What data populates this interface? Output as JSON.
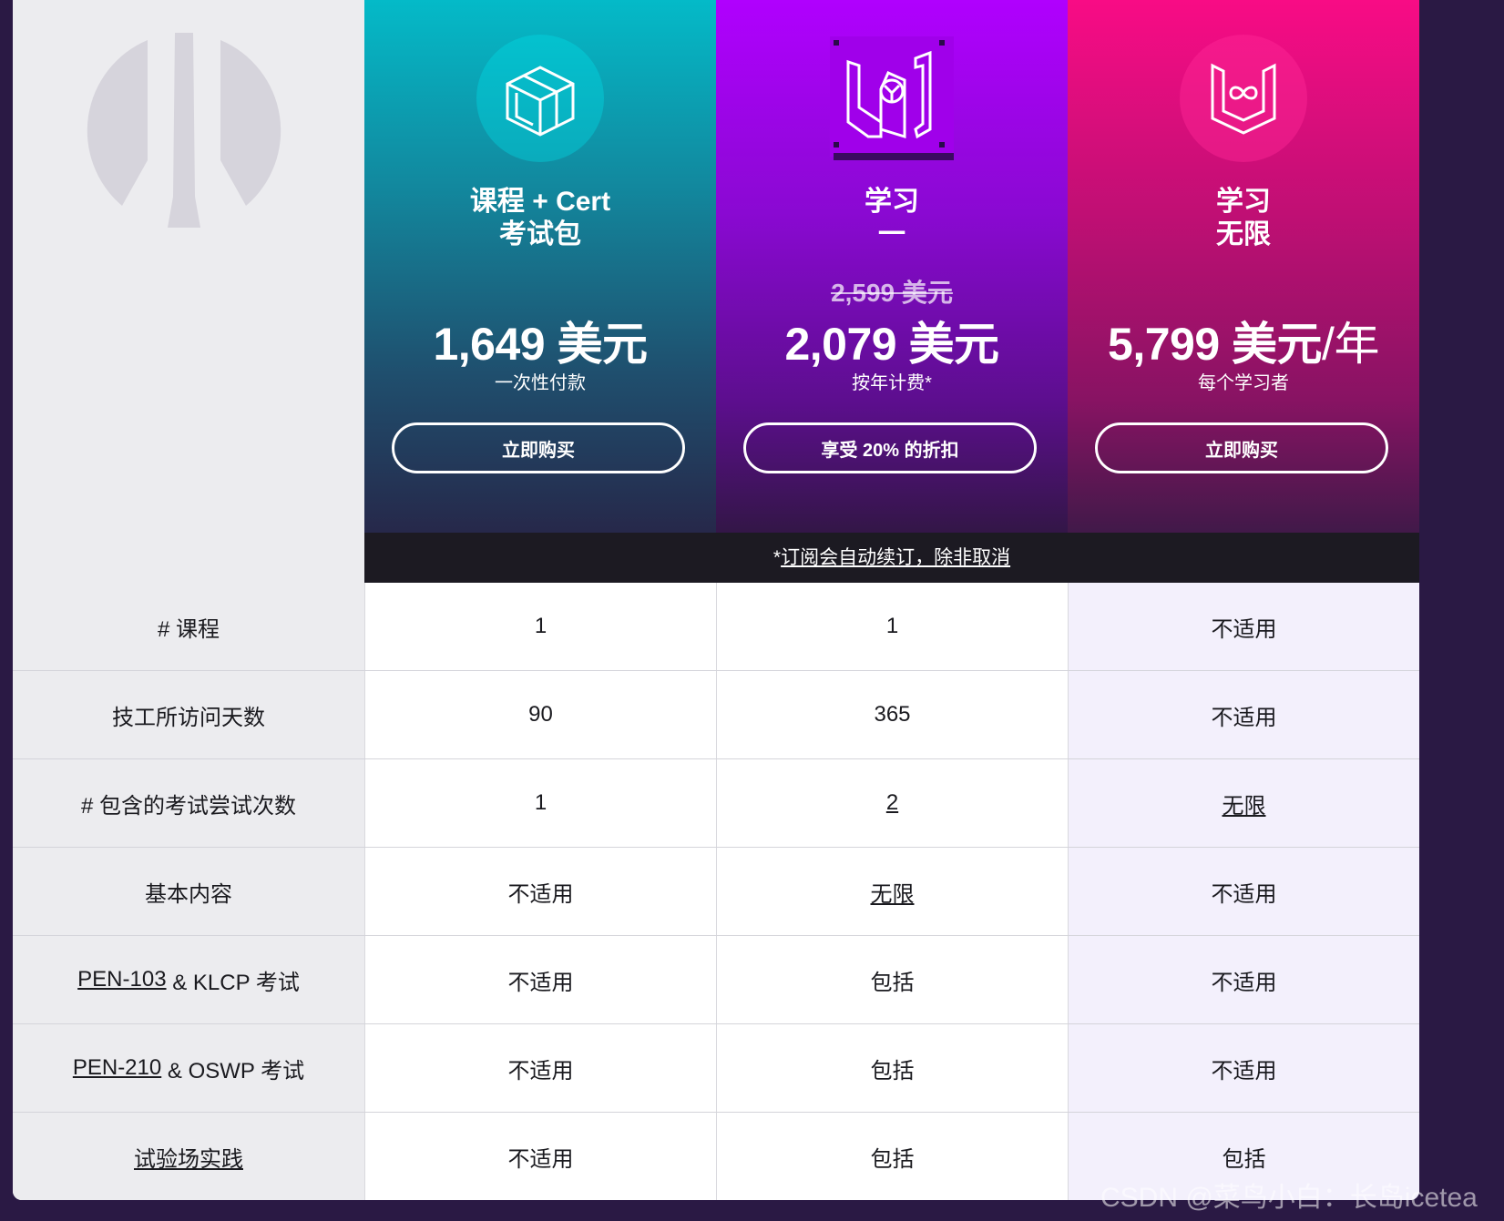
{
  "plans": [
    {
      "title_line1": "课程 + Cert",
      "title_line2": "考试包",
      "old_price": "",
      "price": "1,649 美元",
      "price_unit": "",
      "note": "一次性付款",
      "cta": "立即购买"
    },
    {
      "title_line1": "学习",
      "title_line2": "一",
      "old_price": "2,599 美元",
      "price": "2,079 美元",
      "price_unit": "",
      "note": "按年计费*",
      "cta": "享受 20% 的折扣"
    },
    {
      "title_line1": "学习",
      "title_line2": "无限",
      "old_price": "",
      "price": "5,799 美元",
      "price_unit": "/年",
      "note": "每个学习者",
      "cta": "立即购买"
    }
  ],
  "renew_note": {
    "prefix": "*",
    "link": "订阅会自动续订，除非取消"
  },
  "rows": [
    {
      "label": "# 课程",
      "values": [
        "1",
        "1",
        "不适用"
      ]
    },
    {
      "label": "技工所访问天数",
      "values": [
        "90",
        "365",
        "不适用"
      ]
    },
    {
      "label": "# 包含的考试尝试次数",
      "values": [
        "1",
        "2",
        "无限"
      ]
    },
    {
      "label": "基本内容",
      "values": [
        "不适用",
        "无限",
        "不适用"
      ]
    },
    {
      "label_link": "PEN-103",
      "label_rest": " & KLCP 考试",
      "values": [
        "不适用",
        "包括",
        "不适用"
      ]
    },
    {
      "label_link": "PEN-210",
      "label_rest": " & OSWP 考试",
      "values": [
        "不适用",
        "包括",
        "不适用"
      ]
    },
    {
      "label_link": "试验场实践",
      "label_rest": "",
      "values": [
        "不适用",
        "包括",
        "包括"
      ]
    }
  ],
  "watermark": "CSDN @菜鸟小白：长岛icetea",
  "colors": {
    "course_top": "#04bac8",
    "learn_one_top": "#b000fe",
    "unlimited_top": "#f80c85",
    "page_bg": "#2a1944"
  },
  "icons": {
    "logo": "offsec-logo",
    "course": "cube-icon",
    "learn_one": "learn-one-icon",
    "unlimited": "learn-unlimited-icon"
  }
}
